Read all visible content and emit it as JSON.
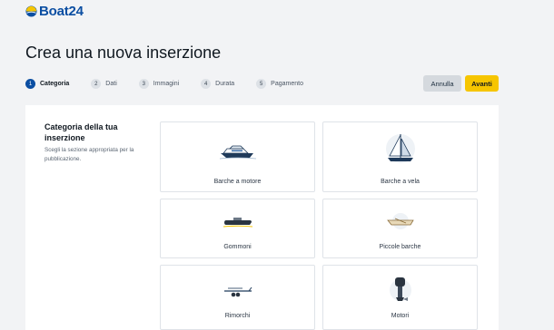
{
  "brand": {
    "name": "Boat24",
    "primary_color": "#0b4ea2",
    "accent_color": "#f6c500"
  },
  "page": {
    "title": "Crea una nuova inserzione"
  },
  "stepper": {
    "steps": [
      {
        "num": "1",
        "label": "Categoria",
        "active": true
      },
      {
        "num": "2",
        "label": "Dati",
        "active": false
      },
      {
        "num": "3",
        "label": "Immagini",
        "active": false
      },
      {
        "num": "4",
        "label": "Durata",
        "active": false
      },
      {
        "num": "5",
        "label": "Pagamento",
        "active": false
      }
    ]
  },
  "actions": {
    "cancel": "Annulla",
    "next": "Avanti"
  },
  "category_panel": {
    "title": "Categoria della tua inserzione",
    "description": "Scegli la sezione appropriata per la pubblicazione.",
    "options": [
      {
        "label": "Barche a motore",
        "icon": "motorboat-icon"
      },
      {
        "label": "Barche a vela",
        "icon": "sailboat-icon"
      },
      {
        "label": "Gommoni",
        "icon": "inflatable-boat-icon"
      },
      {
        "label": "Piccole barche",
        "icon": "small-boat-icon"
      },
      {
        "label": "Rimorchi",
        "icon": "trailer-icon"
      },
      {
        "label": "Motori",
        "icon": "outboard-motor-icon"
      }
    ]
  }
}
